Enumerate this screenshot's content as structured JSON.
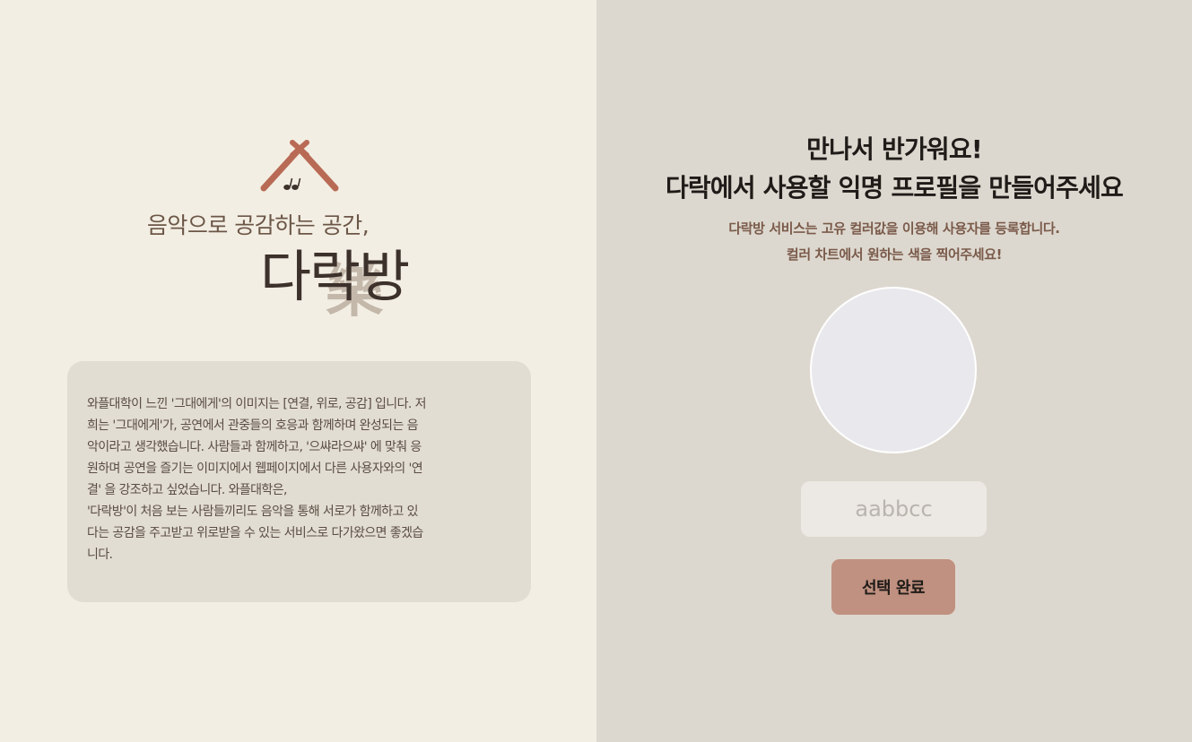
{
  "left": {
    "tagline": "음악으로 공감하는 공간,",
    "logo": "다락방",
    "logo_hanja": "樂",
    "roof_icon": "house-roof-music-notes-icon",
    "description_lines": [
      "와플대학이 느낀 '그대에게'의 이미지는 [연결, 위로, 공감] 입니다. 저",
      "희는 '그대에게'가, 공연에서 관중들의 호응과 함께하며 완성되는 음",
      "악이라고 생각했습니다. 사람들과 함께하고, '으쌰라으쌰' 에 맞춰 응",
      "원하며 공연을 즐기는 이미지에서 웹페이지에서 다른 사용자와의 '연",
      "결' 을 강조하고 싶었습니다. 와플대학은,",
      "'다락방'이 처음 보는 사람들끼리도 음악을 통해 서로가 함께하고 있",
      "다는 공감을 주고받고 위로받을 수 있는 서비스로 다가왔으면 좋겠습",
      "니다."
    ]
  },
  "right": {
    "heading_line1": "만나서 반가워요!",
    "heading_line2": "다락에서 사용할 익명 프로필을 만들어주세요",
    "sub_line1": "다락방 서비스는 고유 컬러값을 이용해 사용자를 등록합니다.",
    "sub_line2": "컬러 차트에서 원하는 색을 찍어주세요!",
    "hex_placeholder": "aabbcc",
    "hex_value": "",
    "selected_color": "#e9e8ec",
    "done_button": "선택 완료"
  },
  "colors": {
    "left_bg": "#f3eee3",
    "right_bg": "#ddd8cf",
    "accent": "#c09180",
    "roof": "#b86a55"
  }
}
